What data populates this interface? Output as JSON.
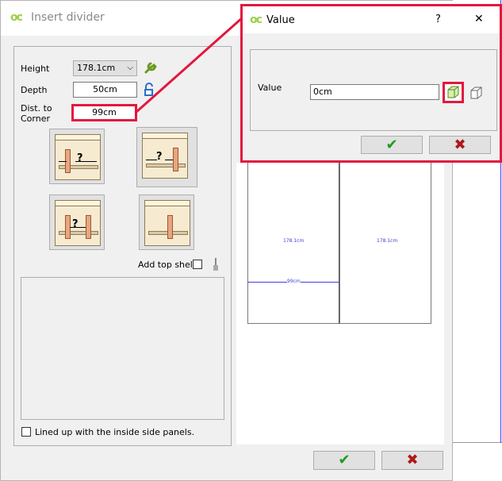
{
  "main_window": {
    "title": "Insert divider",
    "height_label": "Height",
    "height_value": "178.1cm",
    "depth_label": "Depth",
    "depth_value": "50cm",
    "dist_label_line1": "Dist. to",
    "dist_label_line2": "Corner",
    "dist_value": "99cm",
    "add_top_shelf_label": "Add top shelf",
    "lined_up_label": "Lined up with the inside side panels.",
    "question_mark": "?",
    "ok_glyph": "✔",
    "cancel_glyph": "✖"
  },
  "preview": {
    "left_height": "178.1cm",
    "right_height": "178.1cm",
    "dist_marker": "99cm"
  },
  "value_dialog": {
    "title": "Value",
    "help_glyph": "?",
    "close_glyph": "✕",
    "field_label": "Value",
    "field_value": "0cm",
    "ok_glyph": "✔",
    "cancel_glyph": "✖"
  },
  "colors": {
    "highlight": "#e3173e",
    "ok": "#1e9b1e",
    "cancel": "#b01818"
  },
  "icons": [
    "app-logo-icon",
    "wrench-icon",
    "lock-icon",
    "paint-brush-icon",
    "chevron-down-icon",
    "box-3d-filled-icon",
    "box-3d-outline-icon",
    "check-icon",
    "cross-icon"
  ]
}
